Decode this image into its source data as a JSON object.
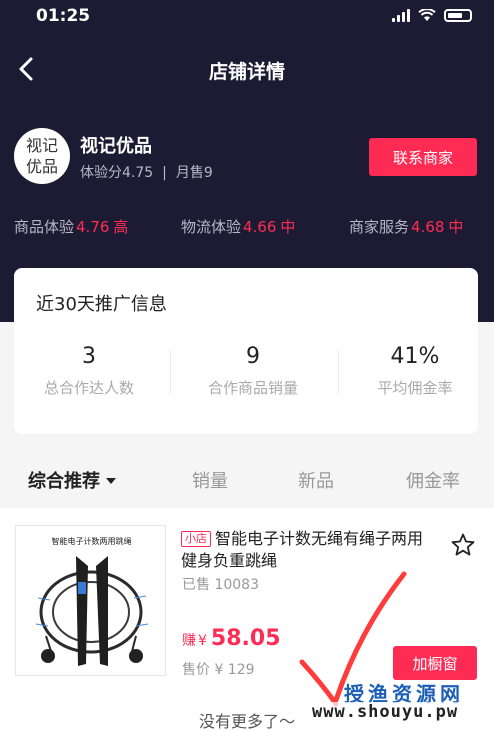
{
  "status_bar": {
    "time": "01:25"
  },
  "nav": {
    "title": "店铺详情"
  },
  "shop": {
    "avatar_text": [
      "视记",
      "优品"
    ],
    "name": "视记优品",
    "experience": "体验分4.75",
    "monthly_sales": "月售9",
    "contact_label": "联系商家"
  },
  "scores": [
    {
      "label": "商品体验",
      "value": "4.76",
      "level": "高"
    },
    {
      "label": "物流体验",
      "value": "4.66",
      "level": "中"
    },
    {
      "label": "商家服务",
      "value": "4.68",
      "level": "中"
    }
  ],
  "promo": {
    "title": "近30天推广信息",
    "stats": [
      {
        "value": "3",
        "label": "总合作达人数"
      },
      {
        "value": "9",
        "label": "合作商品销量"
      },
      {
        "value": "41%",
        "label": "平均佣金率"
      }
    ]
  },
  "sort_tabs": [
    "综合推荐",
    "销量",
    "新品",
    "佣金率"
  ],
  "product": {
    "image_caption": "智能电子计数两用跳绳",
    "store_tag": "小店",
    "title": "智能电子计数无绳有绳子两用健身负重跳绳",
    "sold": "已售 10083",
    "earn_label": "赚",
    "currency": "¥",
    "earn_value": "58.05",
    "price": "售价 ¥ 129",
    "add_label": "加橱窗"
  },
  "footer": {
    "no_more": "没有更多了～"
  },
  "watermark": {
    "line1": "授渔资源网",
    "line2": "www.shouyu.pw"
  },
  "colors": {
    "header_bg": "#1d1b34",
    "accent": "#fe2c55",
    "watermark_blue": "#1c5fb6"
  }
}
